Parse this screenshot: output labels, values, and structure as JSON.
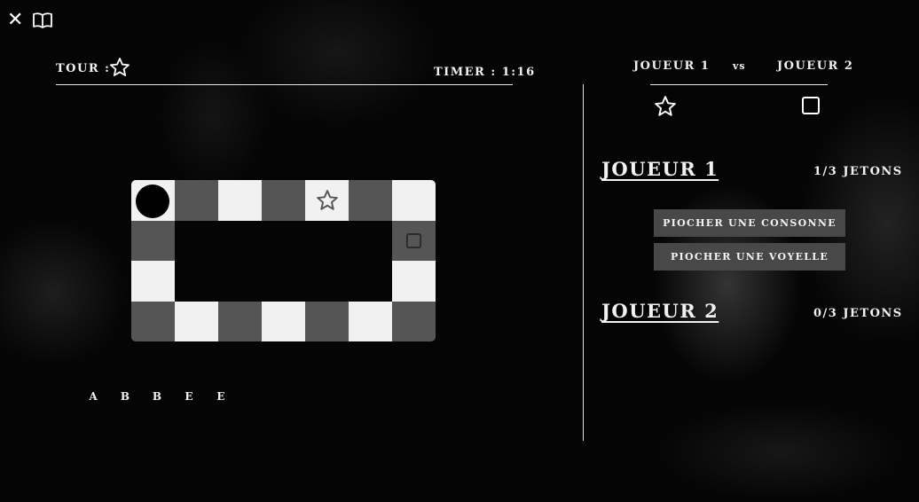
{
  "game": {
    "tour_label": "TOUR :",
    "timer": "TIMER : 1:16",
    "current_turn_symbol": "star-icon"
  },
  "board": {
    "cols": 7,
    "rows": 4,
    "cells": [
      [
        "light",
        "dark",
        "light",
        "dark",
        "light",
        "dark",
        "light"
      ],
      [
        "dark",
        "hole",
        "hole",
        "hole",
        "hole",
        "hole",
        "dark"
      ],
      [
        "light",
        "hole",
        "hole",
        "hole",
        "hole",
        "hole",
        "light"
      ],
      [
        "dark",
        "light",
        "dark",
        "light",
        "dark",
        "light",
        "dark"
      ]
    ],
    "pawns": [
      {
        "row": 0,
        "col": 0,
        "type": "circle"
      },
      {
        "row": 0,
        "col": 4,
        "type": "star"
      },
      {
        "row": 1,
        "col": 6,
        "type": "square"
      }
    ]
  },
  "letters": [
    "A",
    "B",
    "B",
    "E",
    "E"
  ],
  "players_header": {
    "player1": "JOUEUR 1",
    "vs": "vs",
    "player2": "JOUEUR 2",
    "player1_symbol": "star-icon",
    "player2_symbol": "square-icon"
  },
  "player1": {
    "name": "JOUEUR 1",
    "tokens": "1/3 JETONS",
    "btn_consonne": "PIOCHER UNE CONSONNE",
    "btn_voyelle": "PIOCHER UNE VOYELLE"
  },
  "player2": {
    "name": "JOUEUR 2",
    "tokens": "0/3 JETONS"
  },
  "colors": {
    "background": "#000000",
    "light_cell": "#f1f1f1",
    "dark_cell": "#555555",
    "button": "#484848",
    "text": "#f2f2f2"
  }
}
